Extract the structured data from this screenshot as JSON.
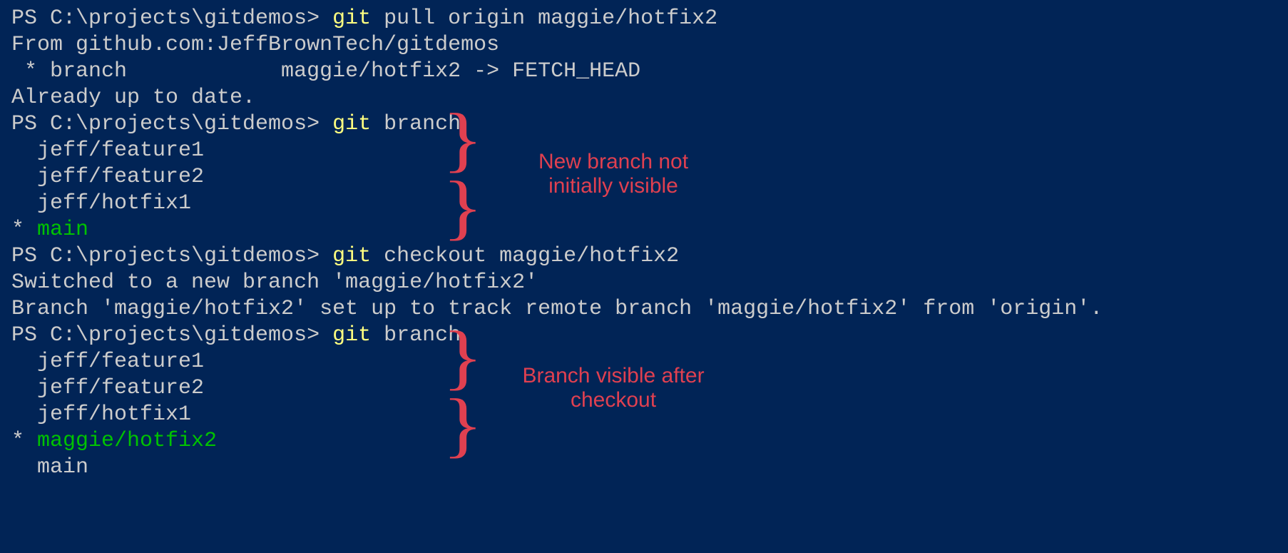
{
  "lines": [
    {
      "prompt": "PS C:\\projects\\gitdemos> ",
      "cmd": "git ",
      "args": "pull origin maggie/hotfix2"
    },
    {
      "out": "From github.com:JeffBrownTech/gitdemos"
    },
    {
      "out": " * branch            maggie/hotfix2 -> FETCH_HEAD"
    },
    {
      "out": "Already up to date."
    },
    {
      "prompt": "PS C:\\projects\\gitdemos> ",
      "cmd": "git ",
      "args": "branch"
    },
    {
      "out": "  jeff/feature1"
    },
    {
      "out": "  jeff/feature2"
    },
    {
      "out": "  jeff/hotfix1"
    },
    {
      "mixed": [
        {
          "t": "* ",
          "c": "out"
        },
        {
          "t": "main",
          "c": "green"
        }
      ]
    },
    {
      "prompt": "PS C:\\projects\\gitdemos> ",
      "cmd": "git ",
      "args": "checkout maggie/hotfix2"
    },
    {
      "out": "Switched to a new branch 'maggie/hotfix2'"
    },
    {
      "out": "Branch 'maggie/hotfix2' set up to track remote branch 'maggie/hotfix2' from 'origin'."
    },
    {
      "prompt": "PS C:\\projects\\gitdemos> ",
      "cmd": "git ",
      "args": "branch"
    },
    {
      "out": "  jeff/feature1"
    },
    {
      "out": "  jeff/feature2"
    },
    {
      "out": "  jeff/hotfix1"
    },
    {
      "mixed": [
        {
          "t": "* ",
          "c": "out"
        },
        {
          "t": "maggie/hotfix2",
          "c": "green"
        }
      ]
    },
    {
      "out": "  main"
    }
  ],
  "annotations": {
    "a1": "New branch not\ninitially visible",
    "a2": "Branch visible\nafter checkout"
  }
}
